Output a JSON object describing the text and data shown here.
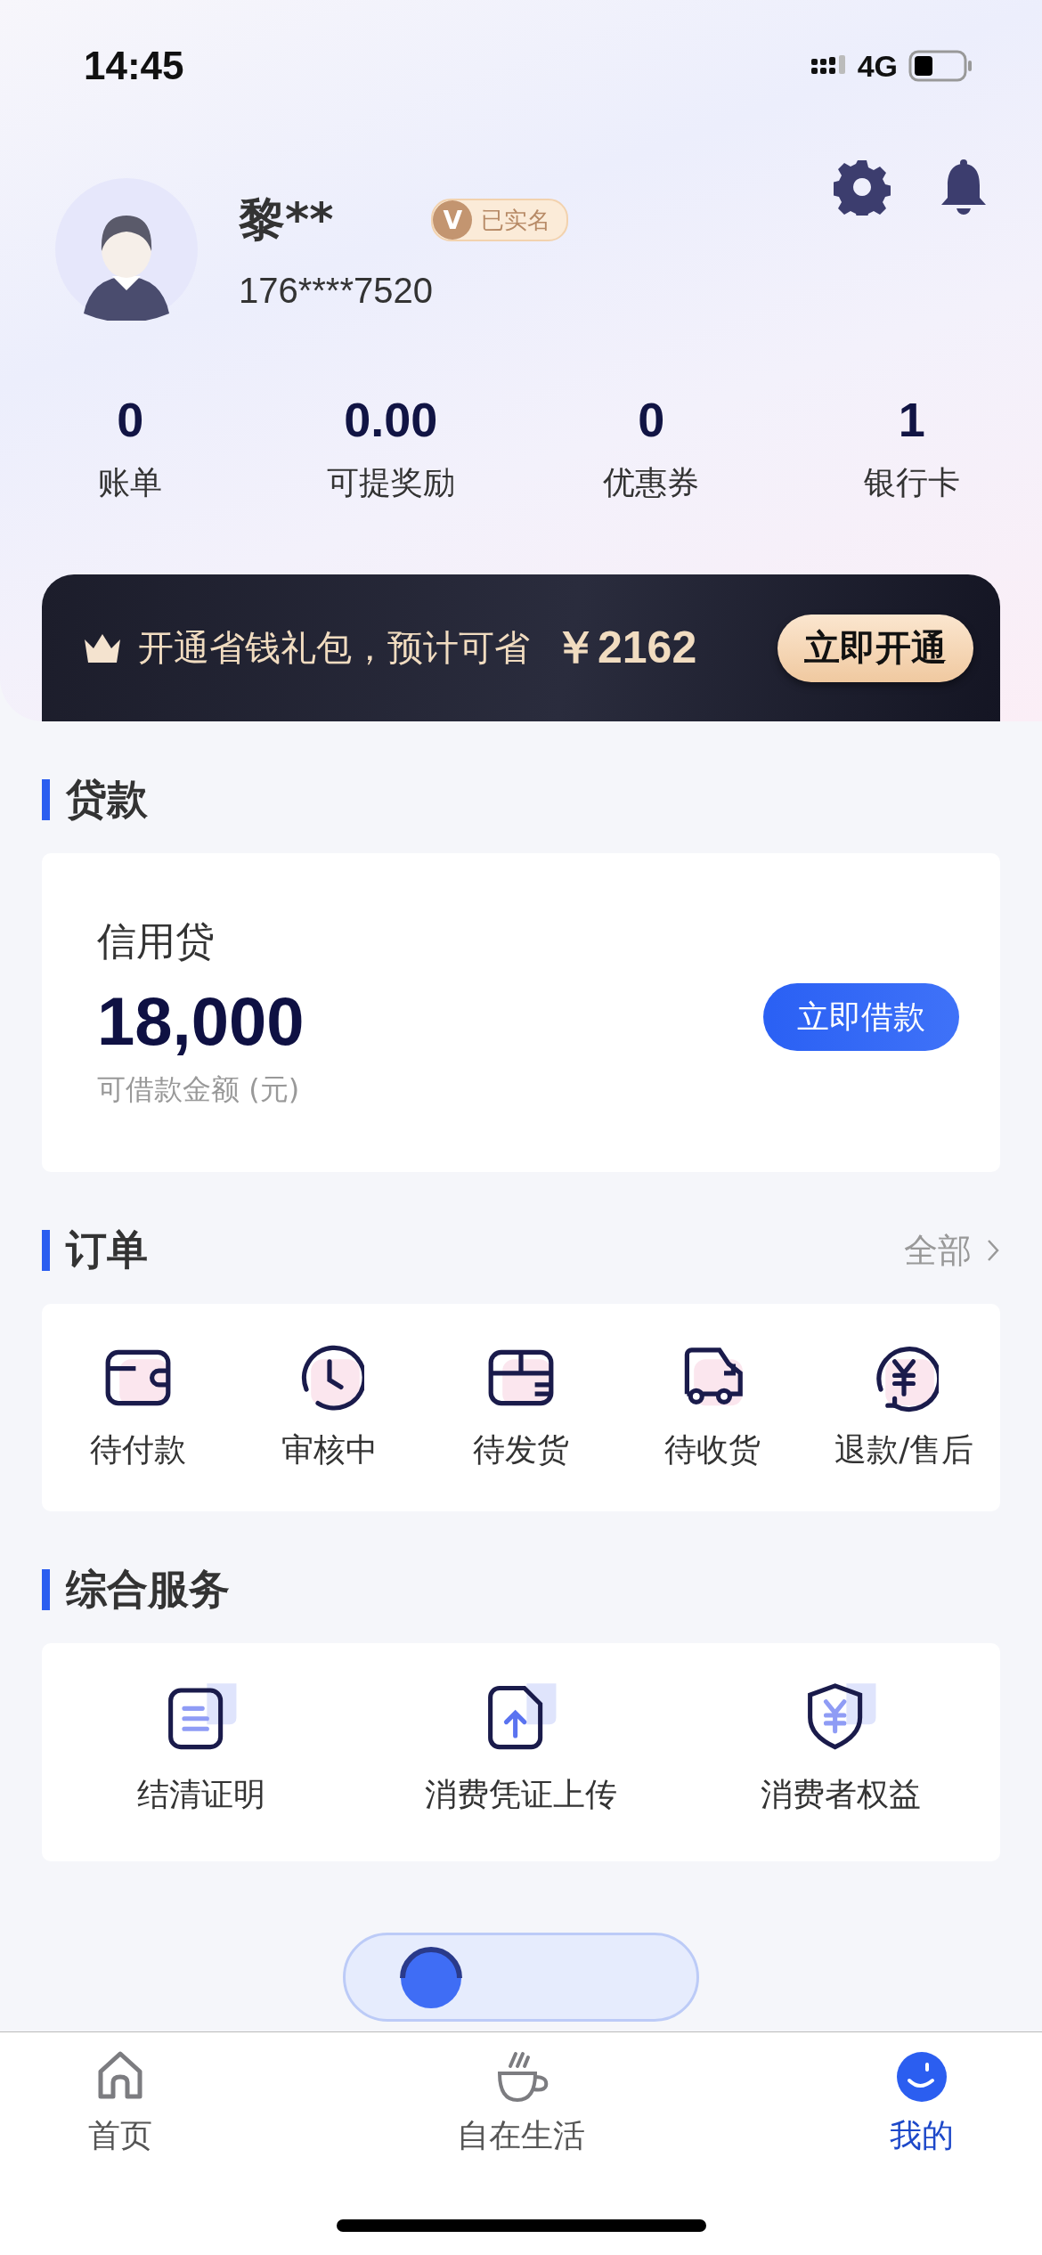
{
  "status_bar": {
    "time": "14:45",
    "network": "4G"
  },
  "profile": {
    "name": "黎**",
    "verified_badge": "已实名",
    "badge_letter": "V",
    "phone": "176****7520"
  },
  "stats": [
    {
      "value": "0",
      "label": "账单"
    },
    {
      "value": "0.00",
      "label": "可提奖励"
    },
    {
      "value": "0",
      "label": "优惠券"
    },
    {
      "value": "1",
      "label": "银行卡"
    }
  ],
  "promo_banner": {
    "text": "开通省钱礼包，预计可省",
    "amount": "￥2162",
    "button": "立即开通"
  },
  "loan_section": {
    "title": "贷款",
    "product": "信用贷",
    "amount": "18,000",
    "amount_label": "可借款金额 (元)",
    "button": "立即借款"
  },
  "orders_section": {
    "title": "订单",
    "link": "全部",
    "items": [
      {
        "kind": "wallet",
        "label": "待付款"
      },
      {
        "kind": "clock",
        "label": "审核中"
      },
      {
        "kind": "box",
        "label": "待发货"
      },
      {
        "kind": "truck",
        "label": "待收货"
      },
      {
        "kind": "refund",
        "label": "退款/售后"
      }
    ]
  },
  "services_section": {
    "title": "综合服务",
    "items": [
      {
        "kind": "document",
        "label": "结清证明"
      },
      {
        "kind": "upload",
        "label": "消费凭证上传"
      },
      {
        "kind": "shield",
        "label": "消费者权益"
      }
    ]
  },
  "contact_button": {
    "kind": "partially_hidden"
  },
  "tab_bar": [
    {
      "kind": "home",
      "label": "首页",
      "selected": false
    },
    {
      "kind": "cup",
      "label": "自在生活",
      "selected": false
    },
    {
      "kind": "smile",
      "label": "我的",
      "selected": true
    }
  ]
}
